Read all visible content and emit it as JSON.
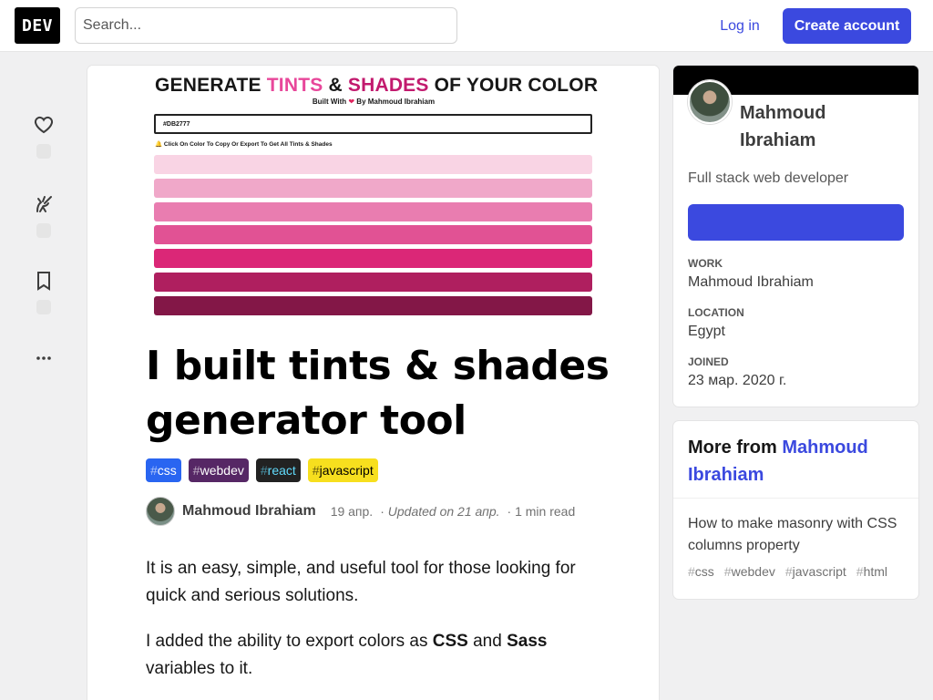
{
  "header": {
    "logo_text": "DEV",
    "search_placeholder": "Search...",
    "login_label": "Log in",
    "create_account_label": "Create account"
  },
  "reactions": {
    "icons": [
      "heart-icon",
      "unicorn-icon",
      "bookmark-icon",
      "more-horizontal-icon"
    ]
  },
  "cover": {
    "title_part1": "GENERATE ",
    "title_part2": "TINTS",
    "title_part3": " & ",
    "title_part4": "SHADES",
    "title_part5": " OF YOUR COLOR",
    "subtitle_before": "Built With ",
    "subtitle_after": " By Mahmoud Ibrahiam",
    "input_value": "#DB2777",
    "hint": "Click On Color To Copy Or Export To Get All Tints & Shades",
    "swatches": [
      "#f9d4e4",
      "#f0a8c9",
      "#e97db0",
      "#e15294",
      "#db2777",
      "#af1f5f",
      "#831747"
    ]
  },
  "article": {
    "title": "I built tints & shades generator tool",
    "tags": [
      {
        "hash": "#",
        "name": "css",
        "bg": "#2965f1",
        "fg": "#ffffff"
      },
      {
        "hash": "#",
        "name": "webdev",
        "bg": "#562765",
        "fg": "#ffffff"
      },
      {
        "hash": "#",
        "name": "react",
        "bg": "#222222",
        "fg": "#61dafb"
      },
      {
        "hash": "#",
        "name": "javascript",
        "bg": "#f7df1e",
        "fg": "#000000"
      }
    ],
    "author": "Mahmoud Ibrahiam",
    "date": "19 апр.",
    "updated": "Updated on 21 апр.",
    "read_time": "1 min read",
    "para1": "It is an easy, simple, and useful tool for those looking for quick and serious solutions.",
    "para2_a": "I added the ability to export colors as ",
    "para2_b": "CSS",
    "para2_c": " and ",
    "para2_d": "Sass",
    "para2_e": " variables to it."
  },
  "profile": {
    "name": "Mahmoud Ibrahiam",
    "bio": "Full stack web developer",
    "work_label": "Work",
    "work_value": "Mahmoud Ibrahiam",
    "location_label": "Location",
    "location_value": "Egypt",
    "joined_label": "Joined",
    "joined_value": "23 мар. 2020 г."
  },
  "more_from": {
    "prefix": "More from ",
    "author": "Mahmoud Ibrahiam",
    "item_title": "How to make masonry with CSS columns property",
    "item_tags": [
      "css",
      "webdev",
      "javascript",
      "html"
    ]
  },
  "colors": {
    "accent": "#3b49df",
    "cover_pink": "#e8479a",
    "cover_pink_dark": "#c21a6e"
  }
}
